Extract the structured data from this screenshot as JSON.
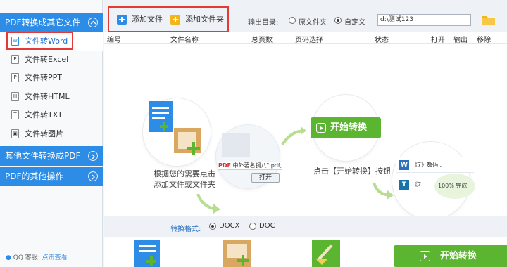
{
  "sidebar": {
    "group1": "PDF转换成其它文件",
    "items": [
      {
        "label": "文件转Word",
        "icon": "W"
      },
      {
        "label": "文件转Excel",
        "icon": "E"
      },
      {
        "label": "文件转PPT",
        "icon": "P"
      },
      {
        "label": "文件转HTML",
        "icon": "H"
      },
      {
        "label": "文件转TXT",
        "icon": "T"
      },
      {
        "label": "文件转图片",
        "icon": "▣"
      }
    ],
    "group2": "其他文件转换成PDF",
    "group3": "PDF的其他操作",
    "support_label": "QQ 客服:",
    "support_link": "点击查看"
  },
  "toolbar": {
    "add_file": "添加文件",
    "add_folder": "添加文件夹",
    "output_label": "输出目录:",
    "opt_original": "原文件夹",
    "opt_custom": "自定义",
    "output_path": "d:\\测试123",
    "selected_option": "自定义"
  },
  "table": {
    "headers": [
      "编号",
      "文件名称",
      "总页数",
      "页码选择",
      "状态",
      "打开",
      "输出",
      "移除"
    ]
  },
  "guide": {
    "step1": "根据您的需要点击",
    "step1b": "添加文件或文件夹",
    "file_chip": "中外著名钢八\".pdf,\"...",
    "open_btn": "打开",
    "start_btn": "开始转换",
    "step2": "点击【开始转换】按钮",
    "doc1": "《7》数码..",
    "doc2": "《7",
    "progress": "100%",
    "progress_label": "完成"
  },
  "format": {
    "label": "转换格式:",
    "opt1": "DOCX",
    "opt2": "DOC",
    "selected": "DOCX"
  },
  "bottom": {
    "start_btn": "开始转换"
  },
  "colors": {
    "accent": "#2c8ce6",
    "green": "#5bb531",
    "highlight": "#e53935"
  }
}
